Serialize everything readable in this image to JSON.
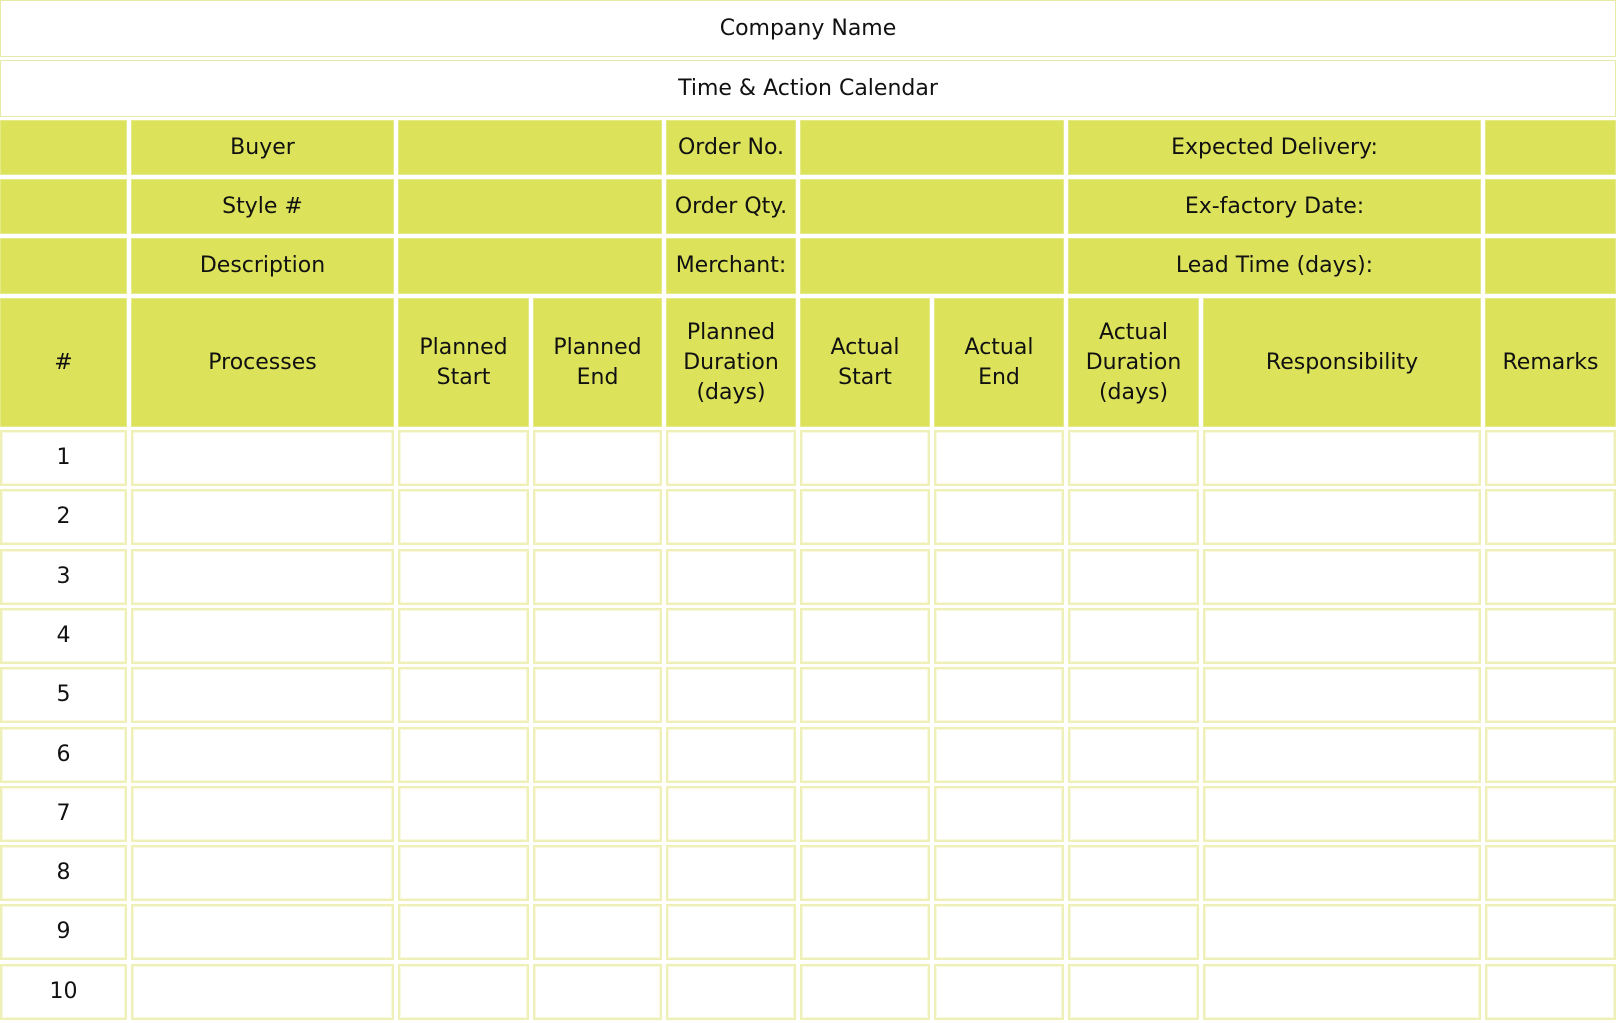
{
  "header": {
    "company_name": "Company Name",
    "document_title": "Time & Action Calendar"
  },
  "meta": {
    "rows": [
      {
        "label": "Buyer",
        "value": "",
        "label2": "Order No.",
        "value2": "",
        "label3": "Expected Delivery:",
        "value3": ""
      },
      {
        "label": "Style #",
        "value": "",
        "label2": "Order Qty.",
        "value2": "",
        "label3": "Ex-factory Date:",
        "value3": ""
      },
      {
        "label": "Description",
        "value": "",
        "label2": "Merchant:",
        "value2": "",
        "label3": "Lead Time (days):",
        "value3": ""
      }
    ]
  },
  "table": {
    "columns": [
      "#",
      "Processes",
      "Planned\nStart",
      "Planned\nEnd",
      "Planned\nDuration\n(days)",
      "Actual\nStart",
      "Actual\nEnd",
      "Actual\nDuration\n(days)",
      "Responsibility",
      "Remarks"
    ],
    "rows": [
      {
        "num": "1"
      },
      {
        "num": "2"
      },
      {
        "num": "3"
      },
      {
        "num": "4"
      },
      {
        "num": "5"
      },
      {
        "num": "6"
      },
      {
        "num": "7"
      },
      {
        "num": "8"
      },
      {
        "num": "9"
      },
      {
        "num": "10"
      }
    ]
  },
  "colors": {
    "header_fill": "#dce35b",
    "cell_border": "#eef0b8",
    "background": "#ffffff"
  }
}
